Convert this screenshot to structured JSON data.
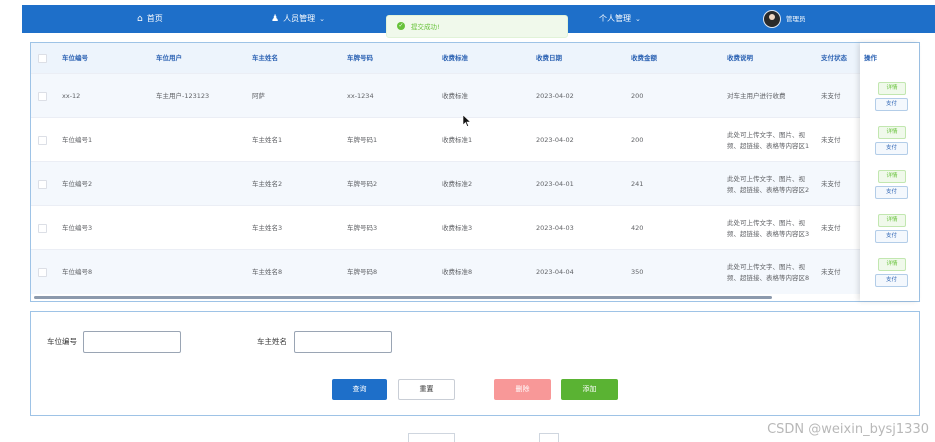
{
  "nav": {
    "home": "首页",
    "people": "人员管理",
    "personal": "个人管理",
    "user": "管理员"
  },
  "toast": {
    "message": "提交成功!"
  },
  "table": {
    "headers": [
      "车位编号",
      "车位用户",
      "车主姓名",
      "车牌号码",
      "收费标准",
      "收费日期",
      "收费金额",
      "收费说明",
      "支付状态"
    ],
    "ops_header": "操作",
    "rows": [
      {
        "c0": "xx-12",
        "c1": "车主用户-123123",
        "c2": "阿萨",
        "c3": "xx-1234",
        "c4": "收费标准",
        "c5": "2023-04-02",
        "c6": "200",
        "c7a": "对车主用户进行收费",
        "c7b": "",
        "c8": "未支付"
      },
      {
        "c0": "车位编号1",
        "c1": "",
        "c2": "车主姓名1",
        "c3": "车牌号码1",
        "c4": "收费标准1",
        "c5": "2023-04-02",
        "c6": "200",
        "c7a": "此处可上传文字、图片、视",
        "c7b": "频、超链接、表格等内容区1",
        "c8": "未支付"
      },
      {
        "c0": "车位编号2",
        "c1": "",
        "c2": "车主姓名2",
        "c3": "车牌号码2",
        "c4": "收费标准2",
        "c5": "2023-04-01",
        "c6": "241",
        "c7a": "此处可上传文字、图片、视",
        "c7b": "频、超链接、表格等内容区2",
        "c8": "未支付"
      },
      {
        "c0": "车位编号3",
        "c1": "",
        "c2": "车主姓名3",
        "c3": "车牌号码3",
        "c4": "收费标准3",
        "c5": "2023-04-03",
        "c6": "420",
        "c7a": "此处可上传文字、图片、视",
        "c7b": "频、超链接、表格等内容区3",
        "c8": "未支付"
      },
      {
        "c0": "车位编号8",
        "c1": "",
        "c2": "车主姓名8",
        "c3": "车牌号码8",
        "c4": "收费标准8",
        "c5": "2023-04-04",
        "c6": "350",
        "c7a": "此处可上传文字、图片、视",
        "c7b": "频、超链接、表格等内容区8",
        "c8": "未支付"
      }
    ],
    "detail_label": "详情",
    "pay_label": "支付"
  },
  "search": {
    "label_spot": "车位编号",
    "value_spot": "",
    "label_owner": "车主姓名",
    "value_owner": "",
    "query_button": "查询",
    "reset_button": "重置",
    "delete_button": "删除",
    "add_button": "添加"
  },
  "watermark": "CSDN @weixin_bysj1330",
  "colors": {
    "nav_bg": "#1e6fc9",
    "success": "#67c23a",
    "query": "#1e6fc9",
    "delete": "#f89898",
    "add": "#5ab333"
  }
}
